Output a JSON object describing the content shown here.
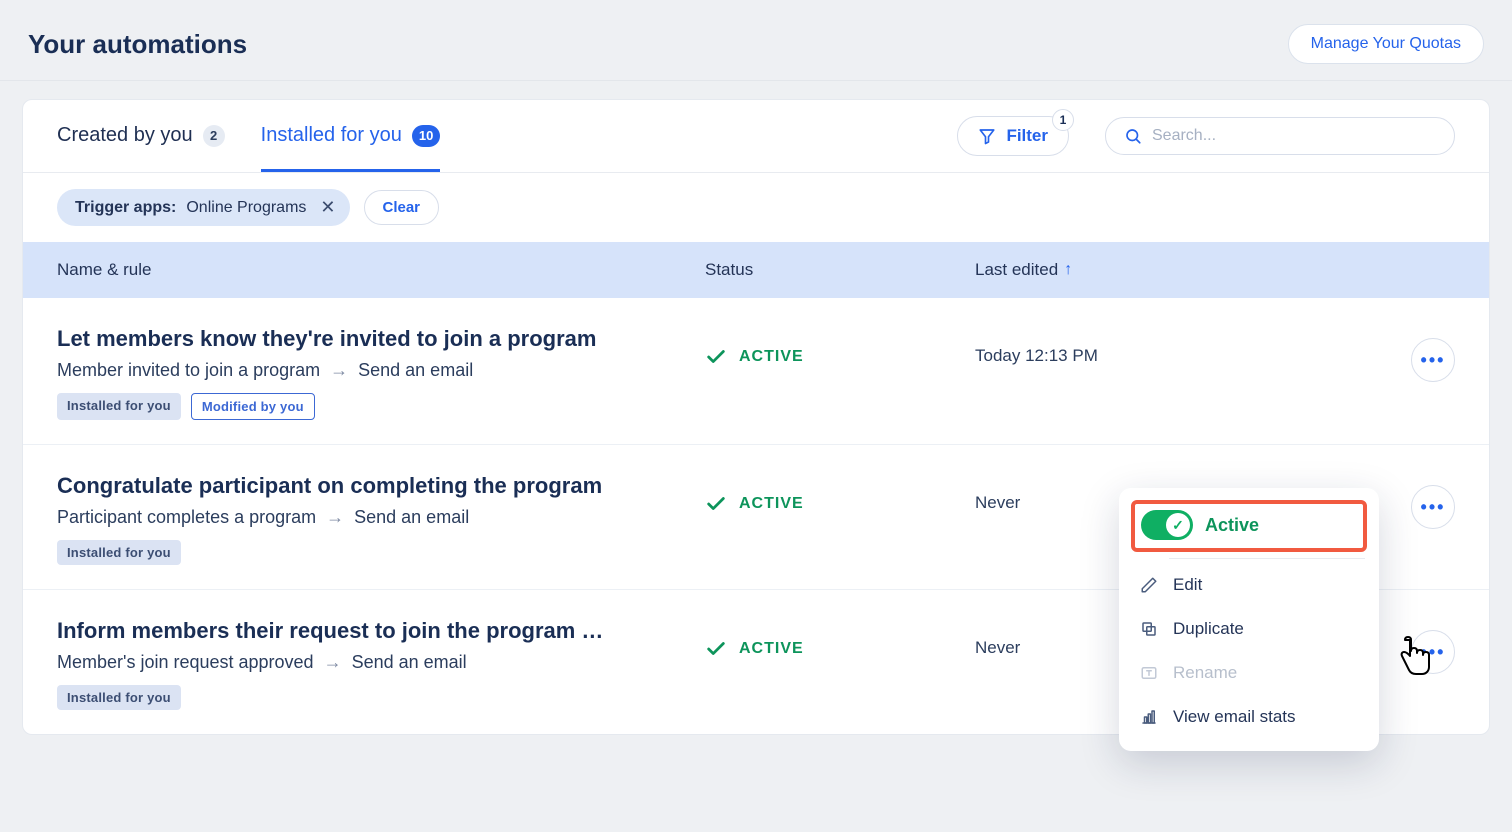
{
  "header": {
    "title": "Your automations",
    "manage_label": "Manage Your Quotas"
  },
  "tabs": {
    "created": {
      "label": "Created by you",
      "count": "2"
    },
    "installed": {
      "label": "Installed for you",
      "count": "10"
    }
  },
  "toolbar": {
    "filter_label": "Filter",
    "filter_count": "1",
    "search_placeholder": "Search..."
  },
  "filters": {
    "chip_label": "Trigger apps:",
    "chip_value": "Online Programs",
    "clear_label": "Clear"
  },
  "columns": {
    "name": "Name & rule",
    "status": "Status",
    "last_edited": "Last edited"
  },
  "rows": [
    {
      "title": "Let members know they're invited to join a program",
      "trigger": "Member invited to join a program",
      "action": "Send an email",
      "status": "ACTIVE",
      "edited": "Today 12:13 PM",
      "installed_badge": "Installed for you",
      "modified_badge": "Modified by you",
      "show_modified": true
    },
    {
      "title": "Congratulate participant on completing the program",
      "trigger": "Participant completes a program",
      "action": "Send an email",
      "status": "ACTIVE",
      "edited": "Never",
      "installed_badge": "Installed for you",
      "show_modified": false
    },
    {
      "title": "Inform members their request to join the program …",
      "trigger": "Member's join request approved",
      "action": "Send an email",
      "status": "ACTIVE",
      "edited": "Never",
      "installed_badge": "Installed for you",
      "show_modified": false
    }
  ],
  "popover": {
    "active_label": "Active",
    "edit": "Edit",
    "duplicate": "Duplicate",
    "rename": "Rename",
    "stats": "View email stats"
  }
}
